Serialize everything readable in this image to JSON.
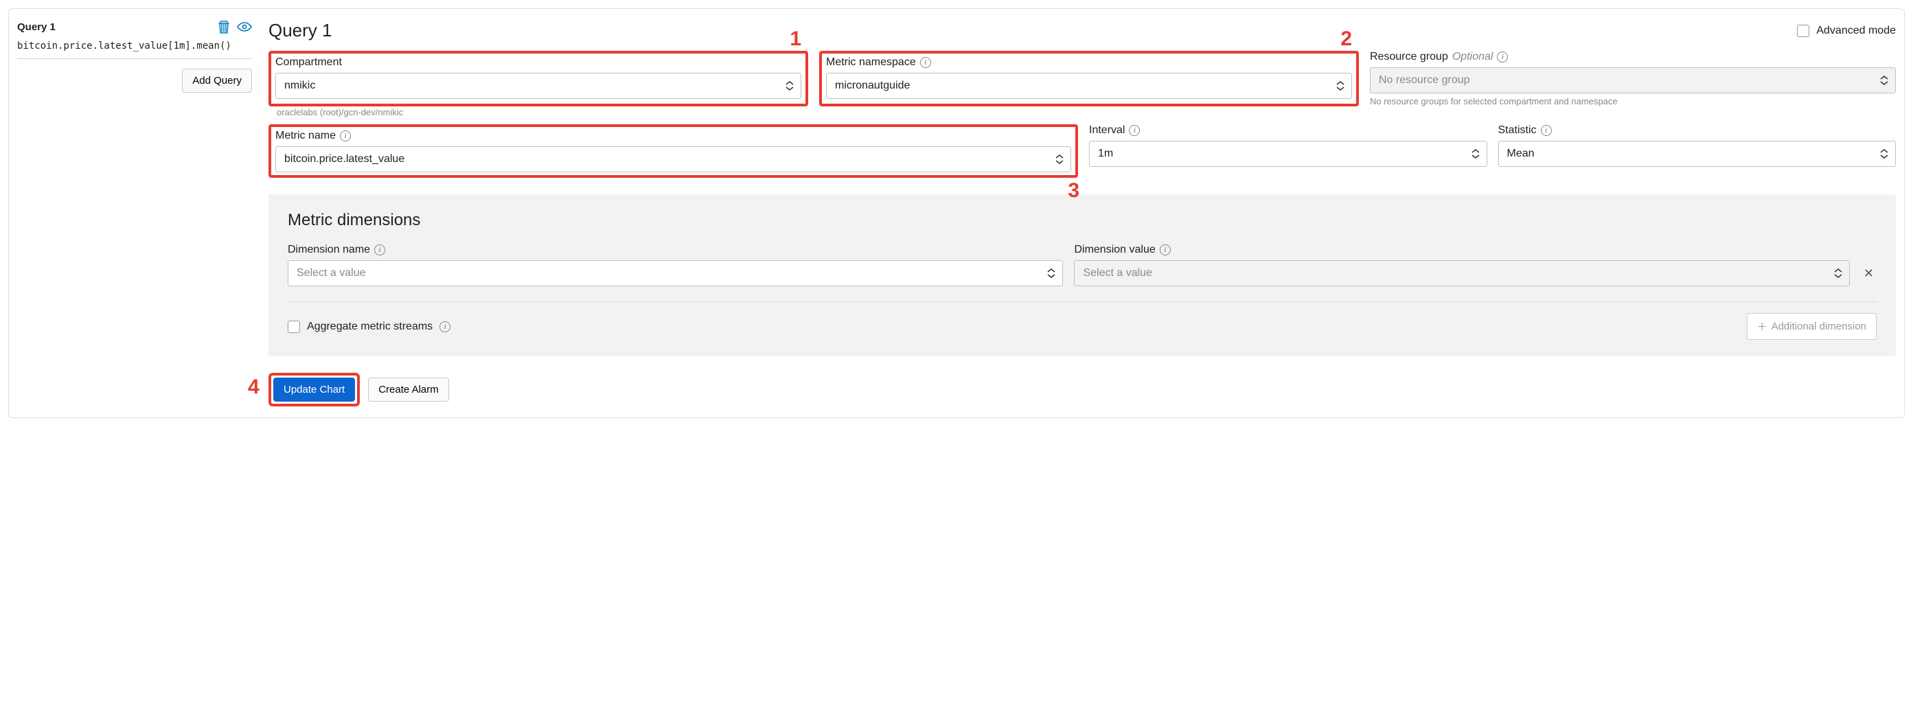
{
  "sidebar": {
    "query_title": "Query 1",
    "query_code": "bitcoin.price.latest_value[1m].mean()",
    "add_query_btn": "Add Query"
  },
  "header": {
    "title": "Query 1",
    "advanced_mode": "Advanced mode"
  },
  "annotations": {
    "a1": "1",
    "a2": "2",
    "a3": "3",
    "a4": "4"
  },
  "fields": {
    "compartment": {
      "label": "Compartment",
      "value": "nmikic",
      "hint": "oraclelabs (root)/gcn-dev/nmikic"
    },
    "namespace": {
      "label": "Metric namespace",
      "value": "micronautguide"
    },
    "resource_group": {
      "label": "Resource group",
      "optional": "Optional",
      "placeholder": "No resource group",
      "hint": "No resource groups for selected compartment and namespace"
    },
    "metric_name": {
      "label": "Metric name",
      "value": "bitcoin.price.latest_value"
    },
    "interval": {
      "label": "Interval",
      "value": "1m"
    },
    "statistic": {
      "label": "Statistic",
      "value": "Mean"
    }
  },
  "dimensions": {
    "title": "Metric dimensions",
    "dim_name_label": "Dimension name",
    "dim_value_label": "Dimension value",
    "select_placeholder": "Select a value",
    "aggregate_label": "Aggregate metric streams",
    "add_dim_btn": "Additional dimension"
  },
  "actions": {
    "update_chart": "Update Chart",
    "create_alarm": "Create Alarm"
  }
}
